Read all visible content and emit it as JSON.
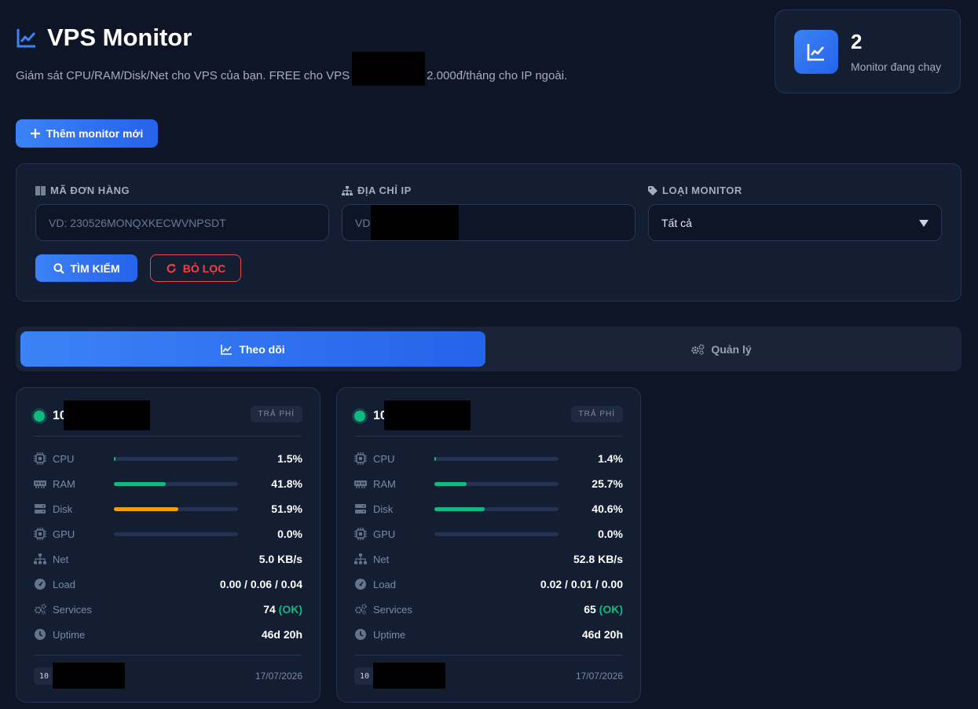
{
  "header": {
    "title": "VPS Monitor",
    "subtitle_start": "Giám sát CPU/RAM/Disk/Net cho VPS của bạn. FREE cho VPS",
    "subtitle_end": "2.000đ/tháng cho IP ngoài."
  },
  "stats": {
    "value": "2",
    "label": "Monitor đang chạy"
  },
  "actions": {
    "add_label": "Thêm monitor mới"
  },
  "filters": {
    "order_label": "MÃ ĐƠN HÀNG",
    "order_placeholder": "VD: 230526MONQXKECWVNPSDT",
    "ip_label": "ĐỊA CHỈ IP",
    "ip_placeholder": "VD",
    "type_label": "LOẠI MONITOR",
    "type_value": "Tất cả",
    "search_label": "TÌM KIẾM",
    "reset_label": "BỎ LỌC"
  },
  "tabs": {
    "monitor": "Theo dõi",
    "manage": "Quản lý"
  },
  "colors": {
    "accent": "#3b82f6",
    "ok": "#10b981",
    "warn": "#f59e0b",
    "danger": "#ef4444"
  },
  "monitors": [
    {
      "ip_prefix": "10",
      "badge": "TRẢ PHÍ",
      "cpu_label": "CPU",
      "cpu": "1.5%",
      "cpu_pct": 1.5,
      "ram_label": "RAM",
      "ram": "41.8%",
      "ram_pct": 41.8,
      "disk_label": "Disk",
      "disk": "51.9%",
      "disk_pct": 51.9,
      "gpu_label": "GPU",
      "gpu": "0.0%",
      "gpu_pct": 0,
      "net_label": "Net",
      "net": "5.0 KB/s",
      "load_label": "Load",
      "load": "0.00 / 0.06 / 0.04",
      "services_label": "Services",
      "services": "74",
      "services_status": "(OK)",
      "uptime_label": "Uptime",
      "uptime": "46d 20h",
      "foot_ip": "10",
      "date": "17/07/2026"
    },
    {
      "ip_prefix": "10",
      "badge": "TRẢ PHÍ",
      "cpu_label": "CPU",
      "cpu": "1.4%",
      "cpu_pct": 1.4,
      "ram_label": "RAM",
      "ram": "25.7%",
      "ram_pct": 25.7,
      "disk_label": "Disk",
      "disk": "40.6%",
      "disk_pct": 40.6,
      "gpu_label": "GPU",
      "gpu": "0.0%",
      "gpu_pct": 0,
      "net_label": "Net",
      "net": "52.8 KB/s",
      "load_label": "Load",
      "load": "0.02 / 0.01 / 0.00",
      "services_label": "Services",
      "services": "65",
      "services_status": "(OK)",
      "uptime_label": "Uptime",
      "uptime": "46d 20h",
      "foot_ip": "10",
      "date": "17/07/2026"
    }
  ]
}
